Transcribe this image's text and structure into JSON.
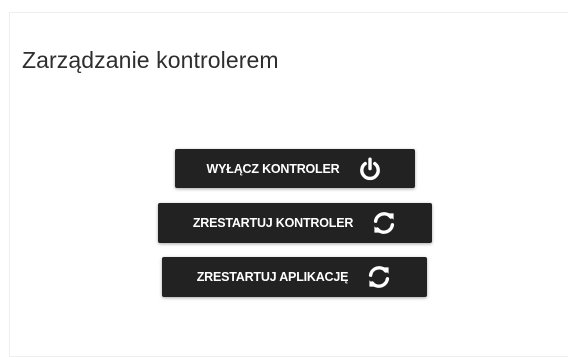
{
  "panel": {
    "title": "Zarządzanie kontrolerem"
  },
  "buttons": {
    "shutdown_label": "WYŁĄCZ KONTROLER",
    "shutdown_icon": "power-icon",
    "restart_controller_label": "ZRESTARTUJ KONTROLER",
    "restart_controller_icon": "sync-icon",
    "restart_app_label": "ZRESTARTUJ APLIKACJĘ",
    "restart_app_icon": "sync-icon"
  },
  "colors": {
    "button_background": "#222222",
    "button_text": "#ffffff",
    "title_text": "#2e2e2e"
  }
}
